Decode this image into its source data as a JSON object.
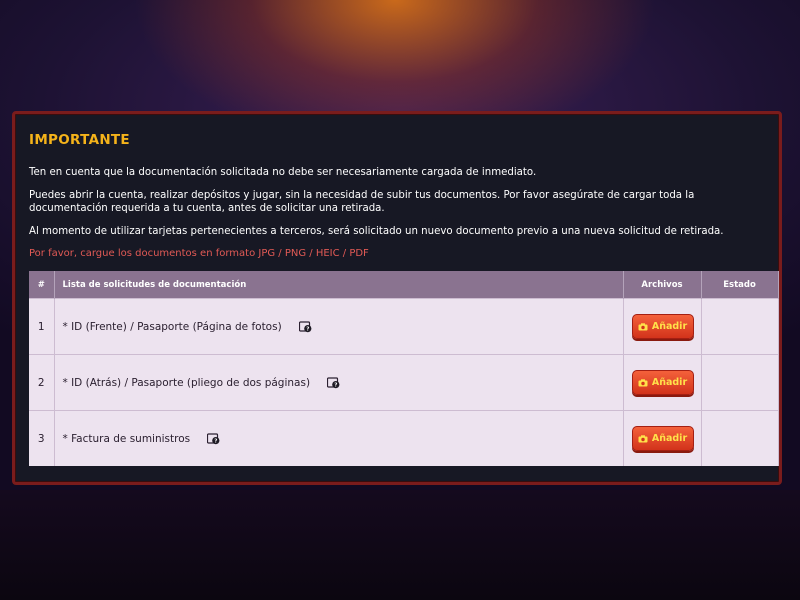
{
  "notice": {
    "title": "IMPORTANTE",
    "paragraphs": [
      "Ten en cuenta que la documentación solicitada no debe ser necesariamente cargada de inmediato.",
      "Puedes abrir la cuenta, realizar depósitos y jugar, sin la necesidad de subir tus documentos. Por favor asegúrate de cargar toda la documentación requerida a tu cuenta, antes de solicitar una retirada.",
      "Al momento de utilizar tarjetas pertenecientes a terceros, será solicitado un nuevo documento previo a una nueva solicitud de retirada."
    ],
    "formats_note": "Por favor, cargue los documentos en formato JPG / PNG / HEIC / PDF"
  },
  "table": {
    "headers": [
      "#",
      "Lista de solicitudes de documentación",
      "Archivos",
      "Estado"
    ],
    "rows": [
      {
        "num": "1",
        "name": "* ID (Frente) / Pasaporte (Página de fotos)",
        "button": "Añadir",
        "status": ""
      },
      {
        "num": "2",
        "name": "* ID (Atrás) / Pasaporte (pliego de dos páginas)",
        "button": "Añadir",
        "status": ""
      },
      {
        "num": "3",
        "name": "* Factura de suministros",
        "button": "Añadir",
        "status": ""
      }
    ]
  },
  "colors": {
    "title": "#f5b31a",
    "formats_note": "#e25a55",
    "button_bg": "#e04a2b",
    "button_text": "#ffe14a",
    "panel_border": "#7a1c1c",
    "table_header": "#8a7390"
  },
  "icons": {
    "help": "document-help-icon",
    "camera": "camera-icon"
  }
}
